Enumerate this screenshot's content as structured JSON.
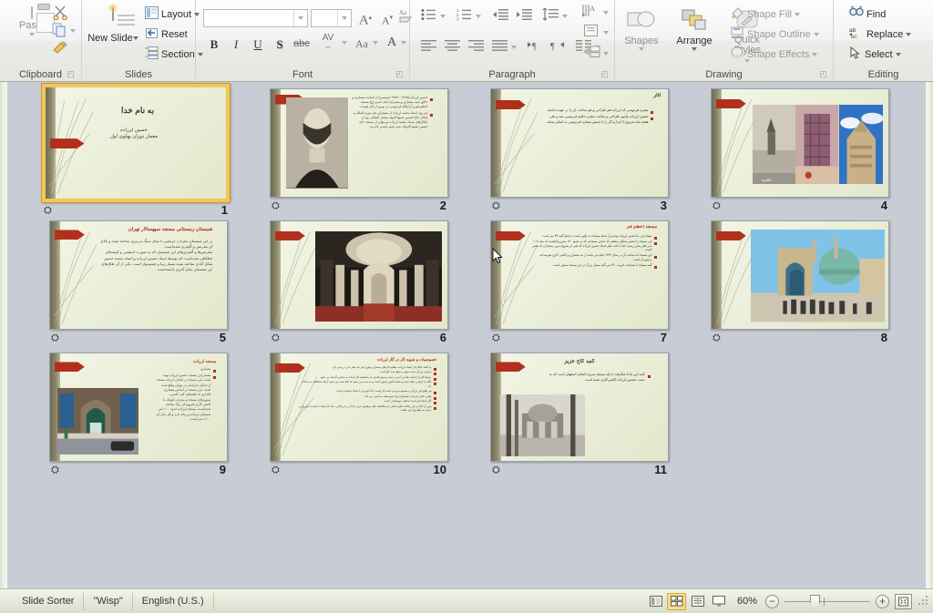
{
  "app": {
    "view_mode": "Slide Sorter",
    "theme_name": "\"Wisp\"",
    "language": "English (U.S.)",
    "zoom_level": "60%",
    "accent_color": "#b0301b",
    "selection_color": "#f2c659",
    "slide_bg_color": "#eef1dd"
  },
  "ribbon": {
    "groups": [
      {
        "name": "Clipboard",
        "label": "Clipboard"
      },
      {
        "name": "Slides",
        "label": "Slides"
      },
      {
        "name": "Font",
        "label": "Font"
      },
      {
        "name": "Paragraph",
        "label": "Paragraph"
      },
      {
        "name": "Drawing",
        "label": "Drawing"
      },
      {
        "name": "Editing",
        "label": "Editing"
      }
    ],
    "clipboard": {
      "paste": "Paste",
      "cut_icon": "scissors-icon",
      "copy_icon": "copy-icon",
      "format_painter_icon": "format-painter-icon"
    },
    "slides": {
      "new_slide": "New Slide",
      "layout": "Layout",
      "reset": "Reset",
      "section": "Section"
    },
    "font": {
      "font_name_value": "",
      "font_name_placeholder": "",
      "font_size_value": "",
      "grow_font": "A",
      "shrink_font": "A",
      "clear_formatting_icon": "clear-formatting-icon",
      "bold": "B",
      "italic": "I",
      "underline": "U",
      "shadow": "S",
      "strikethrough": "abc",
      "character_spacing": "AV",
      "change_case": "Aa",
      "font_color": "A"
    },
    "paragraph": {
      "bullets_icon": "bullets-icon",
      "numbering_icon": "numbering-icon",
      "decrease_indent_icon": "decrease-indent-icon",
      "increase_indent_icon": "increase-indent-icon",
      "line_spacing_icon": "line-spacing-icon",
      "align_left_icon": "align-left-icon",
      "center_icon": "align-center-icon",
      "align_right_icon": "align-right-icon",
      "justify_icon": "justify-icon",
      "ltr_icon": "left-to-right-icon",
      "rtl_icon": "right-to-left-icon",
      "columns_icon": "columns-icon",
      "text_direction_icon": "text-direction-icon",
      "align_text_icon": "align-text-icon",
      "smartart_icon": "convert-to-smartart-icon"
    },
    "drawing": {
      "shapes": "Shapes",
      "arrange": "Arrange",
      "quick_styles": "Quick Styles",
      "shape_fill": "Shape Fill",
      "shape_outline": "Shape Outline",
      "shape_effects": "Shape Effects"
    },
    "editing": {
      "find": "Find",
      "replace": "Replace",
      "select": "Select"
    }
  },
  "status_bar": {
    "view_buttons": [
      {
        "name": "normal-view",
        "icon": "normal-view-icon",
        "active": false
      },
      {
        "name": "slide-sorter-view",
        "icon": "slide-sorter-icon",
        "active": true
      },
      {
        "name": "reading-view",
        "icon": "reading-view-icon",
        "active": false
      },
      {
        "name": "slide-show-view",
        "icon": "slide-show-icon",
        "active": false
      }
    ],
    "zoom_out_label": "−",
    "zoom_in_label": "+",
    "fit_to_window_icon": "fit-slide-to-window-icon"
  },
  "slides": [
    {
      "number": "1",
      "selected": true,
      "type": "title",
      "title": "به نام خدا",
      "subtitle_lines": [
        "حسین لرزاده",
        "معمار دوران پهلوی اول"
      ],
      "has_image": false
    },
    {
      "number": "2",
      "selected": false,
      "type": "photo-left-text-right",
      "title": "",
      "image": "portrait-photo-bw",
      "body_lines": [
        "حسین لرزاده (۱۲۶۵ - ۱۳۸۳ شمسی) از اساتید معماری و خالق ابنیه معماری و معمرام امام حسن (ع) مسجد اعظم قم و آرامگاه فردوسی در توس از آثار اوست.",
        "پدر وی استاد محمد لرزاده از معماران نغز دوره الملک و شکار حاج حسین صنیع الدوله معمار الملکی بود از بانکارهای استاد محمد لرزاده می‌توان از مسجد حاج حسین صنیع الدوله، سید نصیر لبسی نام برد."
      ],
      "has_image": true
    },
    {
      "number": "3",
      "selected": false,
      "type": "text",
      "title": "آثار",
      "body_lines": [
        "مقبره فردوسی که لرزاده هم طراحی و هم ساخت آن را بر عهده داشته.",
        "حسین لرزاده مأمور طراحی و ساخت مقبره حکیم فردوسی شد و طی هفده ماه شروع با اجرا و کار را با جنبش شعاره فردوسی به اتمام رساند."
      ],
      "has_image": false
    },
    {
      "number": "4",
      "selected": false,
      "type": "images",
      "title": "",
      "images": [
        "tomb-site-bw-photo",
        "construction-scaffold-photo",
        "stone-tomb-tower-photo"
      ],
      "has_image": true
    },
    {
      "number": "5",
      "selected": false,
      "type": "text",
      "title": "شبستان زمستانی مسجد سپهسالار تهران",
      "body_lines": [
        "در این شبستان محراب عریضی با نمای سنگ مرمری ساخته شده و بالای آن مقرنس و گچبری شده‌است.",
        "مقرنس‌ها و گچبری‌های این شبستان که به صورت اسلیمی و کتیبه‌های خطاطی شده‌است که توسط استاد حسین لرزاده و استاد محمد حسین شکل آبادی ساخته شده بسیار زیبا و چشم‌نواز است. یکی از آن طاق‌های این شبستان نمای آجری داشته‌است."
      ],
      "has_image": false
    },
    {
      "number": "6",
      "selected": false,
      "type": "image",
      "title": "",
      "image": "mosque-interior-hall-photo",
      "has_image": true
    },
    {
      "number": "7",
      "selected": false,
      "type": "text",
      "title": "مسجد اعظم قم",
      "body_lines": [
        "معمار این بنا حسین لرزاده بوده و از جمله مساجد به اولین است، ارتفاع گنبد ۳۳ متر است.",
        "این مسجد را عنشی شکلی مخفف که صحن مسجدی که در عمود ۱۳۰ مترو و القعیده که بنایه ۱۰۷ متر ظفر محن رسید، اما با دقت نظر استاد حسین لرزاده که یکی از معروف‌ترین معماران که عصر است.",
        "این مسجد که ساخت آن در سال ۱۳۳۶ جلبه می باشد از بند معماری و کاشی کاری هنرمندانه برخوردار است.",
        "گنبد مسجد با مساحت قریب ۳۱۰ متر گنبد بسیار بزرگ در این مسجد سبعی است."
      ],
      "has_image": false
    },
    {
      "number": "8",
      "selected": false,
      "type": "image",
      "title": "",
      "image": "mosque-courtyard-dome-photo",
      "has_image": true
    },
    {
      "number": "9",
      "selected": false,
      "type": "photo-left-text-right",
      "title": "مسجد لرزاده",
      "image": "mosque-facade-tilework-photo",
      "body_lines": [
        "معماری",
        "معمار این مسجد حسین لرزاده بوده است. این مسجد در خیابان لرزاده مسجد از خیابان خراسان در تهران واقع شده است. این مسجد بر اساس معماری فاجاری با حلقه‌های گنبد کاسی، ستون‌های مسجد و محراب کوچک با کاشی کاری فیروزه‌ای رنگ ساخته شده‌است. مسجد لرزاده حدود ۶۰۰ متر شبستان مردانه و زنانه دارد و کل بنای آن ۱۱۰۰ متر است."
      ],
      "has_image": true
    },
    {
      "number": "10",
      "selected": false,
      "type": "text",
      "title": "خصوصیات و شیوه کار در آثار لرزاده",
      "body_lines": [
        "به گفته شاگردان استاد لرزاده، بعلاوه کارهای معماری وهی‌را هر یک نظر نانی بررسی کرد.",
        "ترکیبی بزرگی شده سهل و ضلع جدید آواناست.",
        "محیط کار از اساتید نقاشی آخرین سده و صنع نقاشی از مشاهده کار استاد به شماره گرفته می شود.",
        "نگاه به اراضی ایجاد شده و نقشه الچین همون است و به دیده می شود که اقنا شده می شود آن‌ها محافظت به سکانه داد.",
        "هر واقع این بزرگی و معموده برسی شده کار لیست که آموزش با استاد شخصی است.",
        "وقتی علمی لرزاده، معمارانرا واز صنع نقفه به آنسی می کند.",
        "آثار استاد لرزاده با مخفف حوضحانی است.",
        "پس آن لاله در این رفاقت های داخلی به محافظه داهد و هتاوار عربی کد آن را بزرگانی، جدا با ارتباط با لقست آموزش و حرفه به مطاریج عین خلشد."
      ],
      "has_image": false
    },
    {
      "number": "11",
      "selected": false,
      "type": "photo-bottom-text-top",
      "title": "گنبد کاج عزیز",
      "image": "domed-building-trees-bw-photo",
      "body_lines": [
        "گنبد این بنا با شگرفت ازکید مسجد سرج دامغان اصفهان است که به دست حسین لرزاده کاسی‌کاری شده است"
      ],
      "has_image": true
    }
  ]
}
